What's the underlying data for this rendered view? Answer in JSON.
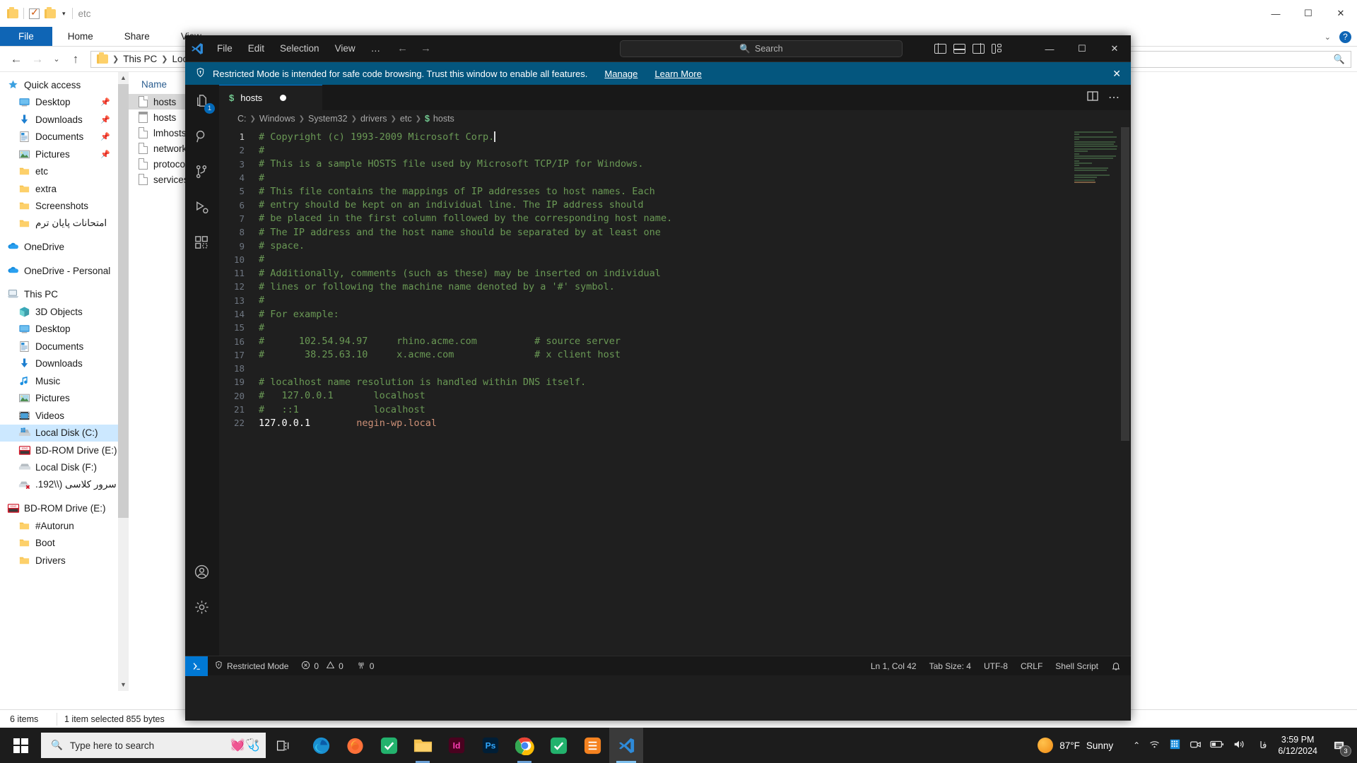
{
  "explorer": {
    "title": "etc",
    "quick_access_icons": [
      "folder-icon",
      "properties-icon",
      "new-folder-icon",
      "customize-caret-icon"
    ],
    "window_controls": {
      "minimize": "—",
      "maximize": "☐",
      "close": "✕"
    },
    "ribbon_tabs": [
      "File",
      "Home",
      "Share",
      "View"
    ],
    "ribbon_active": "File",
    "address": {
      "crumbs": [
        "This PC",
        "Local Di"
      ],
      "search_placeholder": ""
    },
    "tree": [
      {
        "label": "Quick access",
        "icon": "star-icon",
        "indent": 0,
        "pinned": false,
        "selected": false
      },
      {
        "label": "Desktop",
        "icon": "desktop-icon",
        "indent": 1,
        "pinned": true,
        "selected": false
      },
      {
        "label": "Downloads",
        "icon": "downloads-icon",
        "indent": 1,
        "pinned": true,
        "selected": false
      },
      {
        "label": "Documents",
        "icon": "documents-icon",
        "indent": 1,
        "pinned": true,
        "selected": false
      },
      {
        "label": "Pictures",
        "icon": "pictures-icon",
        "indent": 1,
        "pinned": true,
        "selected": false
      },
      {
        "label": "etc",
        "icon": "folder-icon",
        "indent": 1,
        "pinned": false,
        "selected": false
      },
      {
        "label": "extra",
        "icon": "folder-icon",
        "indent": 1,
        "pinned": false,
        "selected": false
      },
      {
        "label": "Screenshots",
        "icon": "folder-icon",
        "indent": 1,
        "pinned": false,
        "selected": false
      },
      {
        "label": "امتحانات پایان ترم",
        "icon": "folder-icon",
        "indent": 1,
        "pinned": false,
        "selected": false,
        "rtl": true
      },
      {
        "label": "",
        "icon": "spacer",
        "indent": 0,
        "spacer": true
      },
      {
        "label": "OneDrive",
        "icon": "onedrive-icon",
        "indent": 0,
        "pinned": false,
        "selected": false
      },
      {
        "label": "",
        "icon": "spacer",
        "indent": 0,
        "spacer": true
      },
      {
        "label": "OneDrive - Personal",
        "icon": "onedrive-icon",
        "indent": 0,
        "pinned": false,
        "selected": false
      },
      {
        "label": "",
        "icon": "spacer",
        "indent": 0,
        "spacer": true
      },
      {
        "label": "This PC",
        "icon": "thispc-icon",
        "indent": 0,
        "pinned": false,
        "selected": false
      },
      {
        "label": "3D Objects",
        "icon": "3dobjects-icon",
        "indent": 1,
        "pinned": false,
        "selected": false
      },
      {
        "label": "Desktop",
        "icon": "desktop-icon",
        "indent": 1,
        "pinned": false,
        "selected": false
      },
      {
        "label": "Documents",
        "icon": "documents-icon",
        "indent": 1,
        "pinned": false,
        "selected": false
      },
      {
        "label": "Downloads",
        "icon": "downloads-icon",
        "indent": 1,
        "pinned": false,
        "selected": false
      },
      {
        "label": "Music",
        "icon": "music-icon",
        "indent": 1,
        "pinned": false,
        "selected": false
      },
      {
        "label": "Pictures",
        "icon": "pictures-icon",
        "indent": 1,
        "pinned": false,
        "selected": false
      },
      {
        "label": "Videos",
        "icon": "videos-icon",
        "indent": 1,
        "pinned": false,
        "selected": false
      },
      {
        "label": "Local Disk (C:)",
        "icon": "localdisk-c-icon",
        "indent": 1,
        "pinned": false,
        "selected": true
      },
      {
        "label": "BD-ROM Drive (E:)",
        "icon": "bdrom-icon",
        "indent": 1,
        "pinned": false,
        "selected": false
      },
      {
        "label": "Local Disk (F:)",
        "icon": "localdisk-icon",
        "indent": 1,
        "pinned": false,
        "selected": false
      },
      {
        "label": "سرور کلاسی (\\\\192.",
        "icon": "network-drive-offline-icon",
        "indent": 1,
        "pinned": false,
        "selected": false,
        "rtl": true
      },
      {
        "label": "",
        "icon": "spacer",
        "indent": 0,
        "spacer": true
      },
      {
        "label": "BD-ROM Drive (E:) ",
        "icon": "bdrom-icon",
        "indent": 0,
        "pinned": false,
        "selected": false
      },
      {
        "label": "#Autorun",
        "icon": "folder-icon",
        "indent": 1,
        "pinned": false,
        "selected": false
      },
      {
        "label": "Boot",
        "icon": "folder-icon",
        "indent": 1,
        "pinned": false,
        "selected": false
      },
      {
        "label": "Drivers",
        "icon": "folder-icon",
        "indent": 1,
        "pinned": false,
        "selected": false
      }
    ],
    "list_header": "Name",
    "files": [
      {
        "name": "hosts",
        "icon": "file-icon",
        "selected": true
      },
      {
        "name": "hosts",
        "icon": "calendar-file-icon",
        "selected": false
      },
      {
        "name": "lmhosts",
        "icon": "file-icon",
        "selected": false
      },
      {
        "name": "networks",
        "icon": "file-icon",
        "selected": false
      },
      {
        "name": "protocol",
        "icon": "file-icon",
        "selected": false
      },
      {
        "name": "services",
        "icon": "file-icon",
        "selected": false
      }
    ],
    "status": {
      "count": "6 items",
      "selection": "1 item selected  855 bytes"
    }
  },
  "vscode": {
    "menu": [
      "File",
      "Edit",
      "Selection",
      "View",
      "…"
    ],
    "nav": {
      "back": "←",
      "forward": "→"
    },
    "search_placeholder": "Search",
    "search_icon": "search-icon",
    "layout_buttons": [
      "toggle-primary-sidebar",
      "toggle-panel",
      "toggle-secondary-sidebar",
      "customize-layout"
    ],
    "window_controls": {
      "minimize": "—",
      "maximize": "☐",
      "close": "✕"
    },
    "banner": {
      "shield_icon": "shield-icon",
      "text": "Restricted Mode is intended for safe code browsing. Trust this window to enable all features.",
      "manage": "Manage",
      "learn_more": "Learn More",
      "close": "✕"
    },
    "activity_bar": [
      {
        "name": "explorer-icon",
        "badge": "1"
      },
      {
        "name": "search-icon",
        "badge": ""
      },
      {
        "name": "source-control-icon",
        "badge": ""
      },
      {
        "name": "run-debug-icon",
        "badge": ""
      },
      {
        "name": "extensions-icon",
        "badge": ""
      }
    ],
    "activity_bottom": [
      {
        "name": "accounts-icon"
      },
      {
        "name": "settings-gear-icon"
      }
    ],
    "tab": {
      "label": "hosts",
      "prefix": "$",
      "dirty": true
    },
    "tab_actions": [
      "split-editor-icon",
      "more-actions-icon"
    ],
    "breadcrumb": [
      "C:",
      "Windows",
      "System32",
      "drivers",
      "etc",
      "hosts"
    ],
    "breadcrumb_file_prefix": "$",
    "editor": {
      "lines": [
        {
          "n": 1,
          "text": "# Copyright (c) 1993-2009 Microsoft Corp.",
          "caret": true
        },
        {
          "n": 2,
          "text": "#"
        },
        {
          "n": 3,
          "text": "# This is a sample HOSTS file used by Microsoft TCP/IP for Windows."
        },
        {
          "n": 4,
          "text": "#"
        },
        {
          "n": 5,
          "text": "# This file contains the mappings of IP addresses to host names. Each"
        },
        {
          "n": 6,
          "text": "# entry should be kept on an individual line. The IP address should"
        },
        {
          "n": 7,
          "text": "# be placed in the first column followed by the corresponding host name."
        },
        {
          "n": 8,
          "text": "# The IP address and the host name should be separated by at least one"
        },
        {
          "n": 9,
          "text": "# space."
        },
        {
          "n": 10,
          "text": "#"
        },
        {
          "n": 11,
          "text": "# Additionally, comments (such as these) may be inserted on individual"
        },
        {
          "n": 12,
          "text": "# lines or following the machine name denoted by a '#' symbol."
        },
        {
          "n": 13,
          "text": "#"
        },
        {
          "n": 14,
          "text": "# For example:"
        },
        {
          "n": 15,
          "text": "#"
        },
        {
          "n": 16,
          "text": "#      102.54.94.97     rhino.acme.com          # source server"
        },
        {
          "n": 17,
          "text": "#       38.25.63.10     x.acme.com              # x client host"
        },
        {
          "n": 18,
          "text": ""
        },
        {
          "n": 19,
          "text": "# localhost name resolution is handled within DNS itself."
        },
        {
          "n": 20,
          "text": "#   127.0.0.1       localhost"
        },
        {
          "n": 21,
          "text": "#   ::1             localhost"
        },
        {
          "n": 22,
          "text": "",
          "special": true,
          "ip": "127.0.0.1",
          "gap": "        ",
          "host": "negin-wp.local"
        }
      ]
    },
    "status_bar": {
      "remote_icon": "remote-window-icon",
      "restricted_mode": "Restricted Mode",
      "restricted_icon": "shield-icon",
      "errors": "0",
      "warnings": "0",
      "ports": "0",
      "ln_col": "Ln 1, Col 42",
      "tab_size": "Tab Size: 4",
      "encoding": "UTF-8",
      "eol": "CRLF",
      "language": "Shell Script",
      "bell_icon": "bell-icon"
    }
  },
  "taskbar": {
    "start_icon": "windows-start-icon",
    "search_placeholder": "Type here to search",
    "search_icon": "search-icon",
    "taskview_icon": "task-view-icon",
    "apps": [
      {
        "name": "edge-icon",
        "running": false
      },
      {
        "name": "firefox-icon",
        "running": false
      },
      {
        "name": "todo-icon",
        "running": false
      },
      {
        "name": "file-explorer-icon",
        "running": true
      },
      {
        "name": "indesign-icon",
        "running": false
      },
      {
        "name": "photoshop-icon",
        "running": false
      },
      {
        "name": "chrome-icon",
        "running": true
      },
      {
        "name": "todo2-icon",
        "running": false
      },
      {
        "name": "orange-app-icon",
        "running": false
      },
      {
        "name": "vscode-icon",
        "running": true,
        "active": true
      }
    ],
    "weather": {
      "icon": "sun-icon",
      "temp": "87°F",
      "condition": "Sunny"
    },
    "tray_icons": [
      "show-hidden-icons-caret",
      "wifi-icon",
      "keyboard-layout-icon",
      "camera-icon",
      "battery-icon",
      "volume-icon"
    ],
    "ime": "فا",
    "time": "3:59 PM",
    "date": "6/12/2024",
    "notification_count": "3",
    "notification_icon": "notification-icon"
  },
  "colors": {
    "vs_accent": "#0078d4",
    "vs_bg": "#1f1f1f",
    "vs_titlebar": "#181818",
    "banner": "#04567e",
    "explorer_sel": "#cce8ff",
    "comment_green": "#6a9955",
    "string_orange": "#ce9178"
  }
}
